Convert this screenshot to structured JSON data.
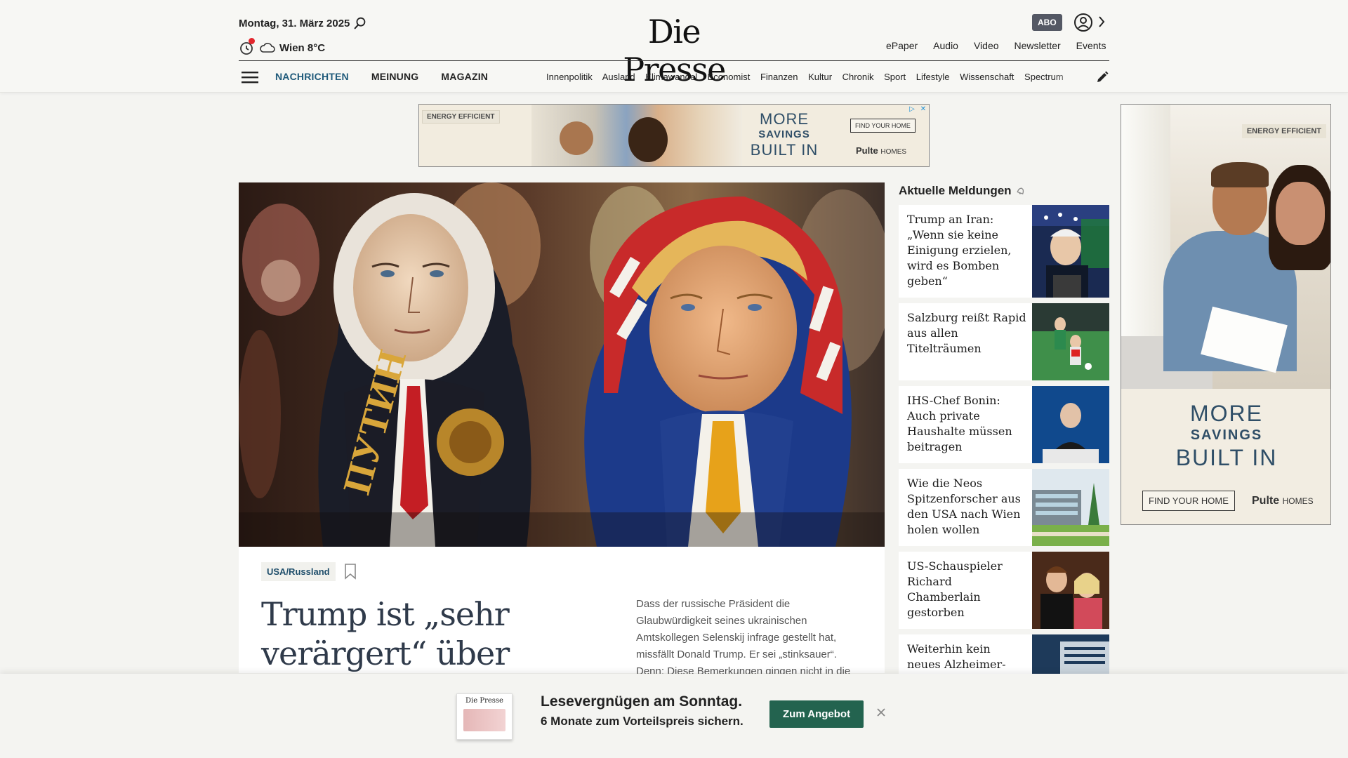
{
  "header": {
    "date": "Montag, 31. März 2025",
    "weather": "Wien 8°C",
    "logo": "Die Presse",
    "abo_label": "ABO",
    "top_links": [
      "ePaper",
      "Audio",
      "Video",
      "Newsletter",
      "Events"
    ],
    "main_nav": [
      "NACHRICHTEN",
      "MEINUNG",
      "MAGAZIN"
    ],
    "sub_nav": [
      "Innenpolitik",
      "Ausland",
      "Klimawandel",
      "Economist",
      "Finanzen",
      "Kultur",
      "Chronik",
      "Sport",
      "Lifestyle",
      "Wissenschaft",
      "Spectrum"
    ]
  },
  "ad_top": {
    "badge": "ENERGY EFFICIENT",
    "line1": "MORE",
    "line2": "SAVINGS",
    "line3": "BUILT IN",
    "cta": "FIND YOUR HOME",
    "brand": "Pulte",
    "brand_suffix": "HOMES"
  },
  "ad_right": {
    "badge": "ENERGY EFFICIENT",
    "line1": "MORE",
    "line2": "SAVINGS",
    "line3": "BUILT IN",
    "cta": "FIND YOUR HOME",
    "brand": "Pulte",
    "brand_suffix": "HOMES"
  },
  "lead_article": {
    "tag": "USA/Russland",
    "headline": "Trump ist „sehr verärgert“ über",
    "lede": "Dass der russische Präsident die Glaubwürdigkeit seines ukrainischen Amtskollegen Selenskij infrage gestellt hat, missfällt Donald Trump. Er sei „stinksauer“. Denn: Diese Bemerkungen gingen nicht in die"
  },
  "aktuelle": {
    "title": "Aktuelle Meldungen",
    "items": [
      {
        "title": "Trump an Iran: „Wenn sie keine Einigung erzielen, wird es Bomben geben“"
      },
      {
        "title": "Salzburg reißt Rapid aus allen Titelträumen"
      },
      {
        "title": "IHS-Chef Bonin: Auch private Haushalte müssen beitragen"
      },
      {
        "title": "Wie die Neos Spitzenforscher aus den USA nach Wien holen wollen"
      },
      {
        "title": "US-Schauspieler Richard Chamberlain gestorben"
      },
      {
        "title": "Weiterhin kein neues Alzheimer-"
      }
    ]
  },
  "promo": {
    "line1": "Lesevergnügen am Sonntag.",
    "line2": "6 Monate zum Vorteilspreis sichern.",
    "button": "Zum Angebot",
    "thumb_logo": "Die Presse"
  },
  "colors": {
    "nav_active": "#1f5a7a",
    "promo_button": "#23634f",
    "abo_badge": "#545864",
    "alert_dot": "#e3262d"
  }
}
